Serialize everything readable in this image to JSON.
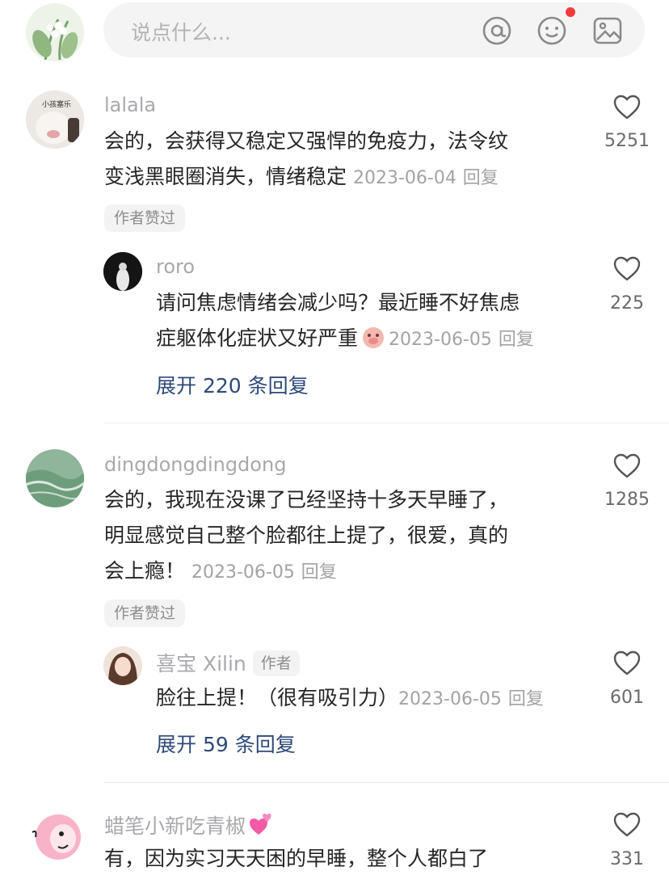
{
  "header": {
    "input_placeholder": "说点什么..."
  },
  "comments": [
    {
      "username": "lalala",
      "avatar_text": "小孩塞乐",
      "text_line1": "会的，会获得又稳定又强悍的免疫力，法令纹",
      "text_line2": "变浅黑眼圈消失，情绪稳定",
      "date": "2023-06-04",
      "reply_label": "回复",
      "likes": "5251",
      "tag": "作者赞过",
      "reply": {
        "username": "roro",
        "text_line1": "请问焦虑情绪会减少吗？最近睡不好焦虑",
        "text_line2": "症躯体化症状又好严重",
        "date": "2023-06-05",
        "reply_label": "回复",
        "likes": "225"
      },
      "expand": "展开 220 条回复"
    },
    {
      "username": "dingdongdingdong",
      "text_line1": "会的，我现在没课了已经坚持十多天早睡了，",
      "text_line2": "明显感觉自己整个脸都往上提了，很爱，真的",
      "text_line3": "会上瘾！",
      "date": "2023-06-05",
      "reply_label": "回复",
      "likes": "1285",
      "tag": "作者赞过",
      "reply": {
        "username": "喜宝 Xilin",
        "author_tag": "作者",
        "text_line1": "脸往上提！（很有吸引力）",
        "date": "2023-06-05",
        "reply_label": "回复",
        "likes": "601"
      },
      "expand": "展开 59 条回复"
    },
    {
      "username": "蜡笔小新吃青椒",
      "text_line1": "有，因为实习天天困的早睡，整个人都白了",
      "likes": "331"
    }
  ],
  "colors": {
    "link": "#2e4a7a",
    "muted": "#a9a9ad",
    "text": "#262626",
    "notification_dot": "#ef3b3b"
  }
}
